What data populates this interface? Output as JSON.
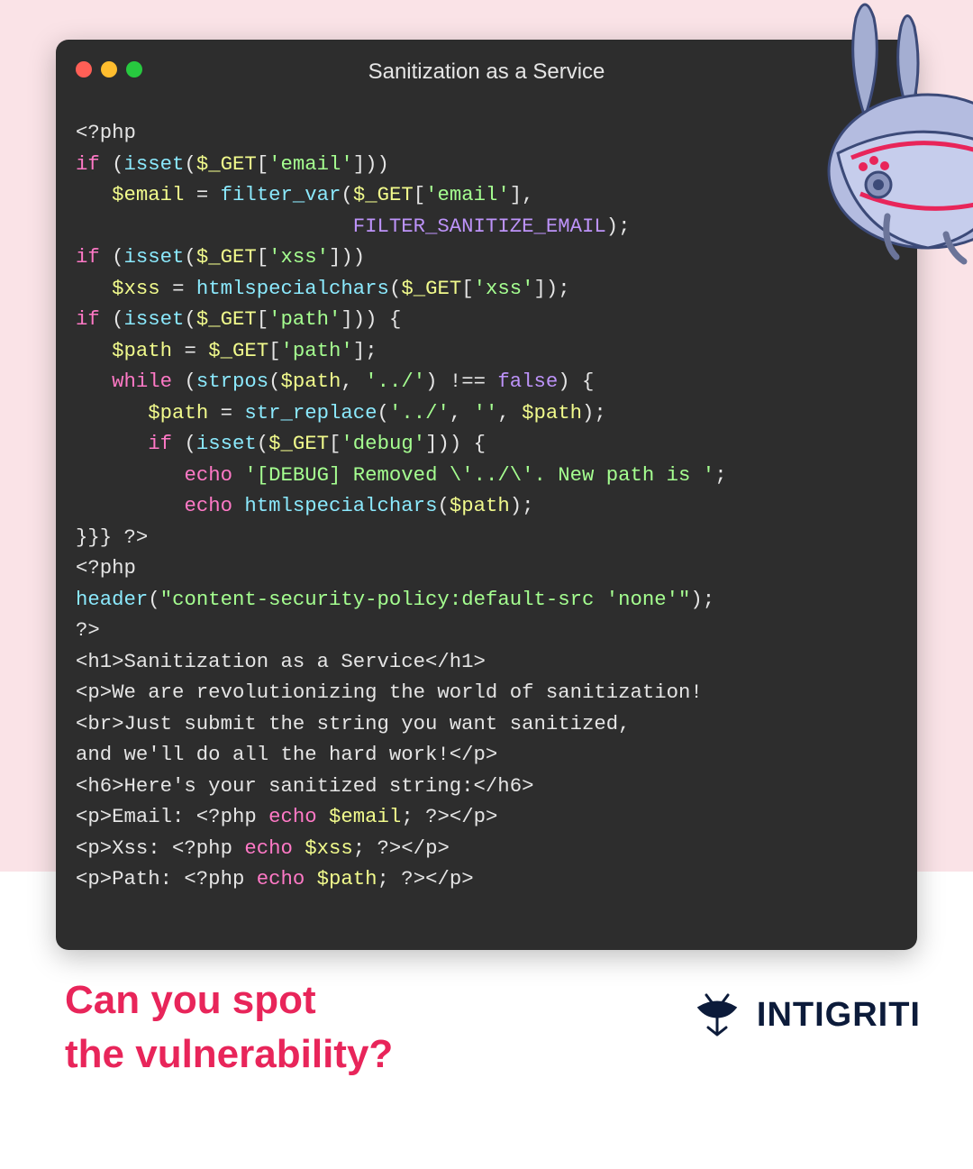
{
  "window_title": "Sanitization as a Service",
  "tagline_line1": "Can you spot",
  "tagline_line2": "the vulnerability?",
  "brand_name": "INTIGRITI",
  "code": {
    "l1_open": "<?php",
    "l2_if": "if",
    "l2_isset": "isset",
    "l2_get": "$_GET",
    "l2_key": "'email'",
    "l3_emailvar": "$email",
    "l3_filter": "filter_var",
    "l3_get": "$_GET",
    "l3_key": "'email'",
    "l4_const": "FILTER_SANITIZE_EMAIL",
    "l5_if": "if",
    "l5_isset": "isset",
    "l5_get": "$_GET",
    "l5_key": "'xss'",
    "l6_xssvar": "$xss",
    "l6_fn": "htmlspecialchars",
    "l6_get": "$_GET",
    "l6_key": "'xss'",
    "l7_if": "if",
    "l7_isset": "isset",
    "l7_get": "$_GET",
    "l7_key": "'path'",
    "l8_pathvar": "$path",
    "l8_get": "$_GET",
    "l8_key": "'path'",
    "l9_while": "while",
    "l9_fn": "strpos",
    "l9_var": "$path",
    "l9_str": "'../'",
    "l9_false": "false",
    "l10_var": "$path",
    "l10_fn": "str_replace",
    "l10_s1": "'../'",
    "l10_s2": "''",
    "l10_v2": "$path",
    "l11_if": "if",
    "l11_isset": "isset",
    "l11_get": "$_GET",
    "l11_key": "'debug'",
    "l12_echo": "echo",
    "l12_str": "'[DEBUG] Removed \\'../\\'. New path is '",
    "l13_echo": "echo",
    "l13_fn": "htmlspecialchars",
    "l13_var": "$path",
    "l14_close": "}}} ?>",
    "l15_open": "<?php",
    "l16_fn": "header",
    "l16_str": "\"content-security-policy:default-src 'none'\"",
    "l17_close": "?>",
    "l18": "<h1>Sanitization as a Service</h1>",
    "l19": "<p>We are revolutionizing the world of sanitization!",
    "l20": "<br>Just submit the string you want sanitized,",
    "l21": "and we'll do all the hard work!</p>",
    "l22": "<h6>Here's your sanitized string:</h6>",
    "l23a": "<p>Email: <?php ",
    "l23_echo": "echo",
    "l23_var": "$email",
    "l23b": "; ?></p>",
    "l24a": "<p>Xss: <?php ",
    "l24_echo": "echo",
    "l24_var": "$xss",
    "l24b": "; ?></p>",
    "l25a": "<p>Path: <?php ",
    "l25_echo": "echo",
    "l25_var": "$path",
    "l25b": "; ?></p>"
  }
}
